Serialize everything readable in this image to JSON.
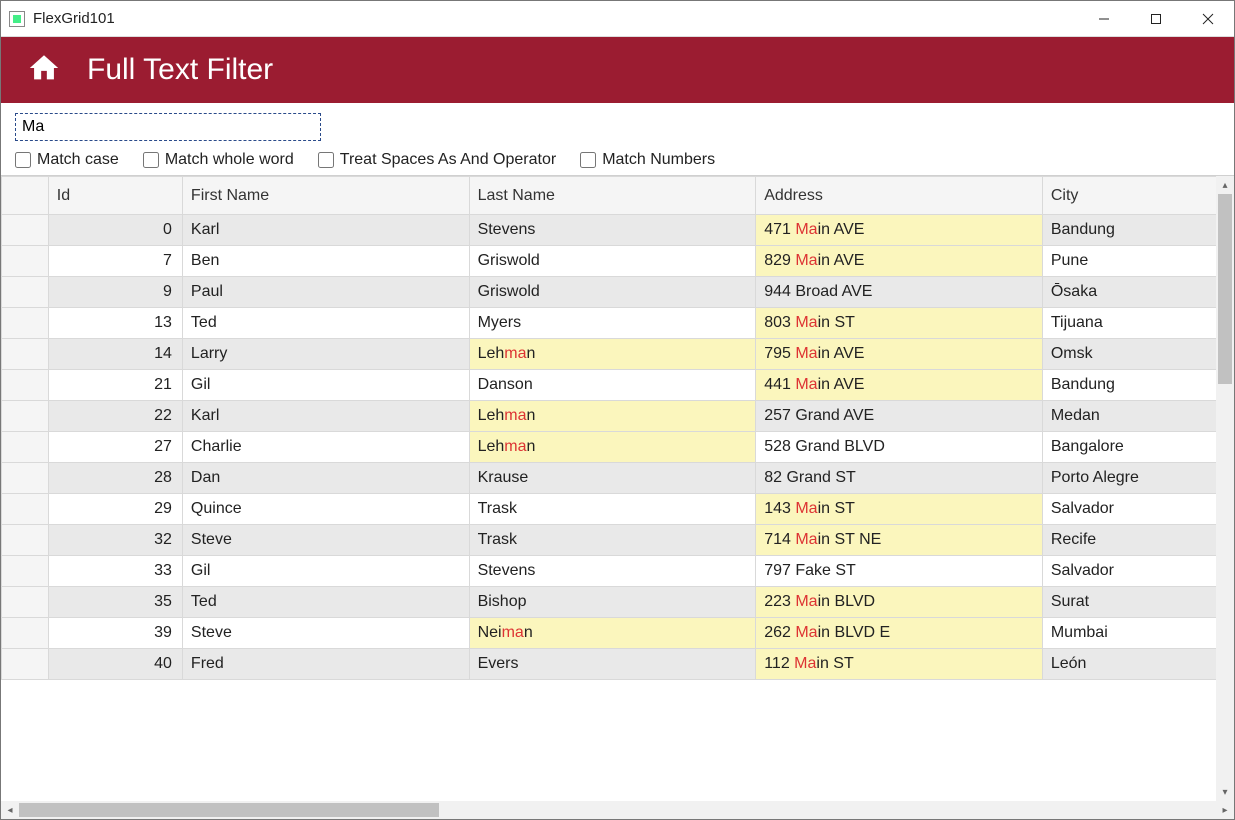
{
  "window": {
    "title": "FlexGrid101"
  },
  "header": {
    "title": "Full Text Filter"
  },
  "filter": {
    "value": "Ma",
    "checks": {
      "match_case": "Match case",
      "match_whole_word": "Match whole word",
      "treat_spaces": "Treat Spaces As And Operator",
      "match_numbers": "Match Numbers"
    }
  },
  "grid": {
    "columns": [
      "Id",
      "First Name",
      "Last Name",
      "Address",
      "City"
    ],
    "highlight": "Ma",
    "rows": [
      {
        "id": 0,
        "first": "Karl",
        "last": "Stevens",
        "address": "471 Main AVE",
        "city": "Bandung",
        "hl": [
          "address"
        ]
      },
      {
        "id": 7,
        "first": "Ben",
        "last": "Griswold",
        "address": "829 Main AVE",
        "city": "Pune",
        "hl": [
          "address"
        ]
      },
      {
        "id": 9,
        "first": "Paul",
        "last": "Griswold",
        "address": "944 Broad AVE",
        "city": "Ōsaka",
        "hl": []
      },
      {
        "id": 13,
        "first": "Ted",
        "last": "Myers",
        "address": "803 Main ST",
        "city": "Tijuana",
        "hl": [
          "address"
        ]
      },
      {
        "id": 14,
        "first": "Larry",
        "last": "Lehman",
        "address": "795 Main AVE",
        "city": "Omsk",
        "hl": [
          "last",
          "address"
        ]
      },
      {
        "id": 21,
        "first": "Gil",
        "last": "Danson",
        "address": "441 Main AVE",
        "city": "Bandung",
        "hl": [
          "address"
        ]
      },
      {
        "id": 22,
        "first": "Karl",
        "last": "Lehman",
        "address": "257 Grand AVE",
        "city": "Medan",
        "hl": [
          "last"
        ]
      },
      {
        "id": 27,
        "first": "Charlie",
        "last": "Lehman",
        "address": "528 Grand BLVD",
        "city": "Bangalore",
        "hl": [
          "last"
        ]
      },
      {
        "id": 28,
        "first": "Dan",
        "last": "Krause",
        "address": "82 Grand ST",
        "city": "Porto Alegre",
        "hl": []
      },
      {
        "id": 29,
        "first": "Quince",
        "last": "Trask",
        "address": "143 Main ST",
        "city": "Salvador",
        "hl": [
          "address"
        ]
      },
      {
        "id": 32,
        "first": "Steve",
        "last": "Trask",
        "address": "714 Main ST NE",
        "city": "Recife",
        "hl": [
          "address"
        ]
      },
      {
        "id": 33,
        "first": "Gil",
        "last": "Stevens",
        "address": "797 Fake ST",
        "city": "Salvador",
        "hl": []
      },
      {
        "id": 35,
        "first": "Ted",
        "last": "Bishop",
        "address": "223 Main BLVD",
        "city": "Surat",
        "hl": [
          "address"
        ]
      },
      {
        "id": 39,
        "first": "Steve",
        "last": "Neiman",
        "address": "262 Main BLVD E",
        "city": "Mumbai",
        "hl": [
          "last",
          "address"
        ]
      },
      {
        "id": 40,
        "first": "Fred",
        "last": "Evers",
        "address": "112 Main ST",
        "city": "León",
        "hl": [
          "address"
        ]
      }
    ]
  }
}
